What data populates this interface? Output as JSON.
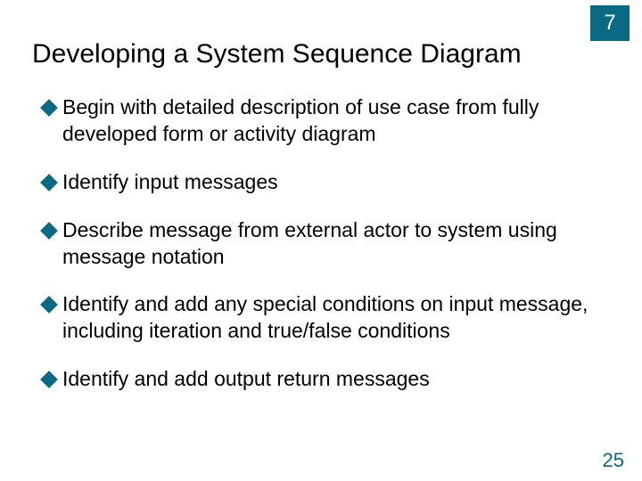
{
  "chapter": "7",
  "title": "Developing a System Sequence Diagram",
  "bullets": [
    "Begin with detailed description of use case from fully developed form or activity diagram",
    "Identify input messages",
    "Describe message from external actor to system using message notation",
    "Identify and add any special conditions on input message, including iteration and true/false conditions",
    "Identify and add output return messages"
  ],
  "page_number": "25",
  "colors": {
    "accent": "#0a6a83"
  }
}
